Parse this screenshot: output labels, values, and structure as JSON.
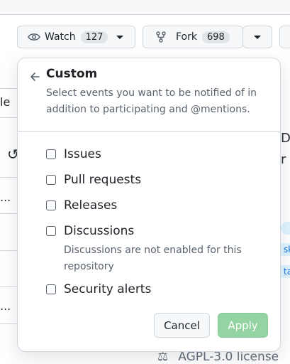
{
  "header": {
    "watch": {
      "label": "Watch",
      "count": "127"
    },
    "fork": {
      "label": "Fork",
      "count": "698"
    }
  },
  "background": {
    "left_frag_1": "le",
    "left_frag_2": "...",
    "left_frag_3": "...",
    "right_frag_1": "Da",
    "right_frag_2": "r",
    "right_frag_3": "sk",
    "right_frag_4": "ta",
    "license": "AGPL-3.0 license"
  },
  "panel": {
    "title": "Custom",
    "subtitle": "Select events you want to be notified of in addition to participating and @mentions.",
    "options": [
      {
        "label": "Issues"
      },
      {
        "label": "Pull requests"
      },
      {
        "label": "Releases"
      },
      {
        "label": "Discussions",
        "note": "Discussions are not enabled for this repository"
      },
      {
        "label": "Security alerts"
      }
    ],
    "cancel_label": "Cancel",
    "apply_label": "Apply"
  }
}
